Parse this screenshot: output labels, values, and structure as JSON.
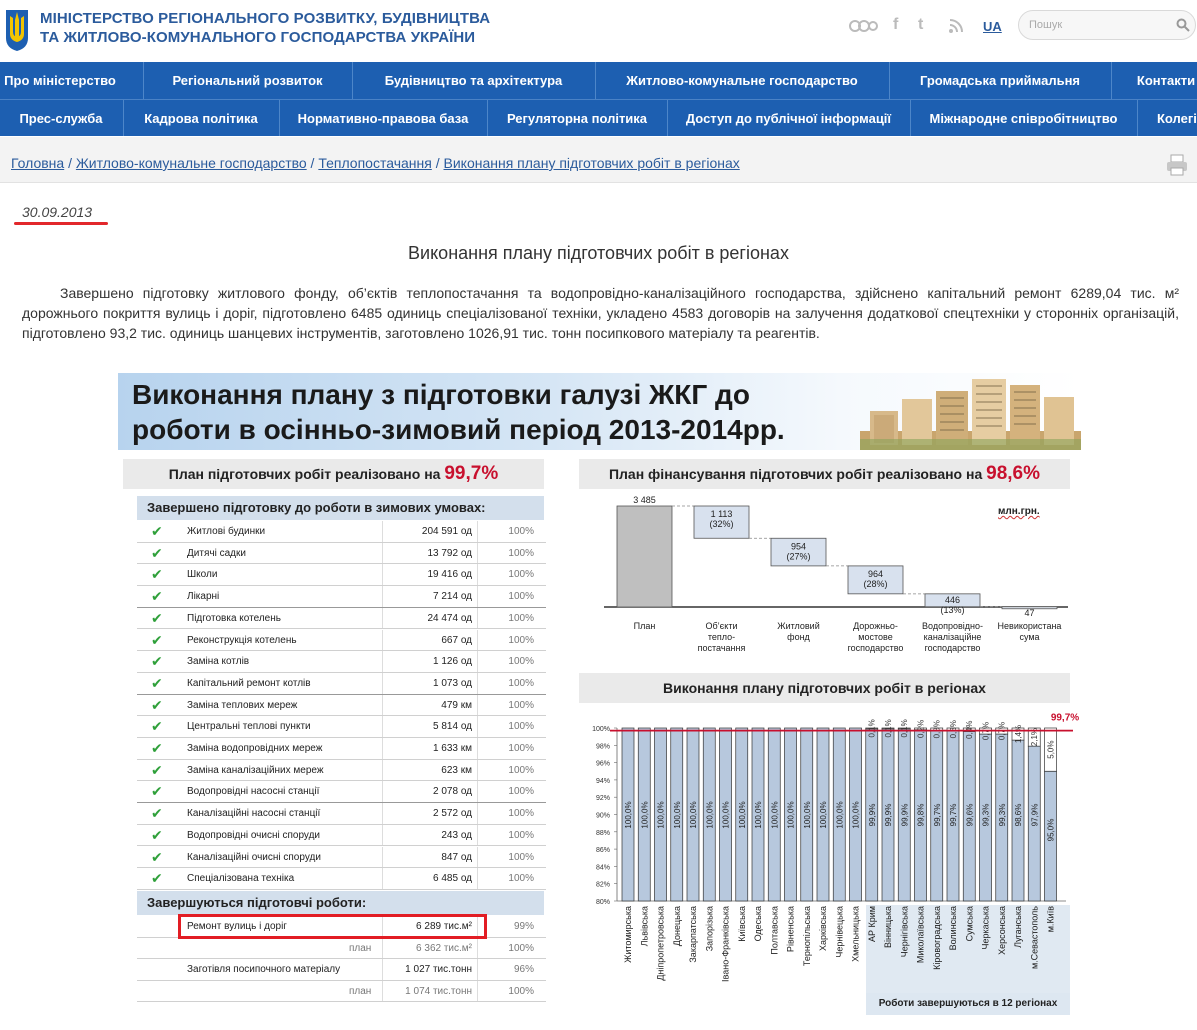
{
  "header": {
    "title_line1": "МІНІСТЕРСТВО РЕГІОНАЛЬНОГО РОЗВИТКУ, БУДІВНИЦТВА",
    "title_line2": "ТА ЖИТЛОВО-КОМУНАЛЬНОГО ГОСПОДАРСТВА УКРАЇНИ",
    "lang": "UA",
    "search_placeholder": "Пошук",
    "social": [
      "flickr-icon",
      "facebook-icon",
      "twitter-icon",
      "rss-icon"
    ]
  },
  "nav1": [
    "Про міністерство",
    "Регіональний розвиток",
    "Будівництво та архітектура",
    "Житлово-комунальне господарство",
    "Громадська приймальня",
    "Контакти"
  ],
  "nav2": [
    "Прес-служба",
    "Кадрова політика",
    "Нормативно-правова база",
    "Регуляторна політика",
    "Доступ до публічної інформації",
    "Міжнародне співробітництво",
    "Колегія"
  ],
  "breadcrumb": [
    "Головна",
    "Житлово-комунальне господарство",
    "Теплопостачання",
    "Виконання плану підготовчих робіт в регіонах"
  ],
  "article": {
    "date": "30.09.2013",
    "title": "Виконання плану підготовчих робіт в регіонах",
    "body": "Завершено підготовку житлового фонду, об’єктів теплопостачання та водопровідно-каналізаційного господарства, здійснено капітальний ремонт 6289,04 тис. м² дорожнього покриття вулиць і доріг, підготовлено 6485 одиниць спеціалізованої техніки, укладено 4583 договорів на залучення додаткової спецтехніки у сторонніх організацій, підготовлено 93,2 тис. одиниць шанцевих інструментів, заготовлено 1026,91 тис. тонн посипкового матеріалу та реагентів."
  },
  "infographic": {
    "banner_line1": "Виконання плану з підготовки галузі ЖКГ до",
    "banner_line2": "роботи в осінньо-зимовий період 2013-2014рр.",
    "left_header": "План підготовчих робіт реалізовано на",
    "left_pct": "99,7%",
    "completed_header": "Завершено підготовку до роботи в зимових умовах:",
    "completed": [
      {
        "name": "Житлові будинки",
        "value": "204 591 од",
        "pct": "100%"
      },
      {
        "name": "Дитячі садки",
        "value": "13 792 од",
        "pct": "100%"
      },
      {
        "name": "Школи",
        "value": "19 416 од",
        "pct": "100%"
      },
      {
        "name": "Лікарні",
        "value": "7 214 од",
        "pct": "100%"
      },
      {
        "name": "Підготовка котелень",
        "value": "24 474 од",
        "pct": "100%"
      },
      {
        "name": "Реконструкція котелень",
        "value": "667 од",
        "pct": "100%"
      },
      {
        "name": "Заміна котлів",
        "value": "1 126 од",
        "pct": "100%"
      },
      {
        "name": "Капітальний ремонт котлів",
        "value": "1 073 од",
        "pct": "100%"
      },
      {
        "name": "Заміна теплових мереж",
        "value": "479 км",
        "pct": "100%"
      },
      {
        "name": "Центральні теплові пункти",
        "value": "5 814 од",
        "pct": "100%"
      },
      {
        "name": "Заміна водопровідних мереж",
        "value": "1 633 км",
        "pct": "100%"
      },
      {
        "name": "Заміна каналізаційних мереж",
        "value": "623 км",
        "pct": "100%"
      },
      {
        "name": "Водопровідні насосні станції",
        "value": "2 078 од",
        "pct": "100%"
      },
      {
        "name": "Каналізаційні насосні станції",
        "value": "2 572 од",
        "pct": "100%"
      },
      {
        "name": "Водопровідні очисні споруди",
        "value": "243 од",
        "pct": "100%"
      },
      {
        "name": "Каналізаційні очисні споруди",
        "value": "847 од",
        "pct": "100%"
      },
      {
        "name": "Спеціалізована техніка",
        "value": "6 485 од",
        "pct": "100%"
      }
    ],
    "ongoing_header": "Завершуються підготовчі роботи:",
    "ongoing": [
      {
        "name": "Ремонт вулиць і доріг",
        "value": "6 289 тис.м²",
        "pct": "99%"
      },
      {
        "name": "план",
        "value": "6 362 тис.м²",
        "pct": "100%"
      },
      {
        "name": "Заготівля посипочного матеріалу",
        "value": "1 027 тис.тонн",
        "pct": "96%"
      },
      {
        "name": "план",
        "value": "1 074 тис.тонн",
        "pct": "100%"
      }
    ],
    "fin_header": "План фінансування підготовчих робіт реалізовано на",
    "fin_pct": "98,6%",
    "fin_unit": "млн.грн.",
    "regions_header": "Виконання плану підготовчих робіт в регіонах",
    "regions_footer": "Роботи завершуються в 12 регіонах"
  },
  "chart_data": [
    {
      "type": "bar",
      "title": "План фінансування підготовчих робіт реалізовано на 98,6%",
      "ylabel": "млн.грн.",
      "categories": [
        "План",
        "Об’єкти тепло-постачання",
        "Житловий фонд",
        "Дорожньо-мостове господарство",
        "Водопровідно-каналізаційне господарство",
        "Невикористана сума"
      ],
      "values": [
        3485,
        1113,
        954,
        964,
        446,
        47
      ],
      "labels": [
        "3 485",
        "1 113",
        "954",
        "964",
        "446",
        "47"
      ],
      "shares": [
        "",
        "(32%)",
        "(27%)",
        "(28%)",
        "(13%)",
        ""
      ]
    },
    {
      "type": "bar",
      "title": "Виконання плану підготовчих робіт в регіонах",
      "ylim": [
        80,
        100
      ],
      "yticks": [
        "80%",
        "82%",
        "84%",
        "86%",
        "88%",
        "90%",
        "92%",
        "94%",
        "96%",
        "98%",
        "100%"
      ],
      "target_label": "99,7%",
      "target": 99.7,
      "categories": [
        "Житомирська",
        "Львівська",
        "Дніпропетровська",
        "Донецька",
        "Закарпатська",
        "Запорізька",
        "Івано-Франківська",
        "Київська",
        "Одеська",
        "Полтавська",
        "Рівненська",
        "Тернопільська",
        "Харківська",
        "Чернівецька",
        "Хмельницька",
        "АР Крим",
        "Вінницька",
        "Чернігівська",
        "Миколаївська",
        "Кіровоградська",
        "Волинська",
        "Сумська",
        "Черкаська",
        "Херсонська",
        "Луганська",
        "м.Севастополь",
        "м.Київ"
      ],
      "series": [
        {
          "values": [
            100,
            100,
            100,
            100,
            100,
            100,
            100,
            100,
            100,
            100,
            100,
            100,
            100,
            100,
            100,
            99.9,
            99.9,
            99.9,
            99.8,
            99.7,
            99.7,
            99.6,
            99.3,
            99.3,
            98.6,
            97.9,
            95.0
          ],
          "labels": [
            "100,0%",
            "100,0%",
            "100,0%",
            "100,0%",
            "100,0%",
            "100,0%",
            "100,0%",
            "100,0%",
            "100,0%",
            "100,0%",
            "100,0%",
            "100,0%",
            "100,0%",
            "100,0%",
            "100,0%",
            "99,9%",
            "99,9%",
            "99,9%",
            "99,8%",
            "99,7%",
            "99,7%",
            "99,6%",
            "99,3%",
            "99,3%",
            "98,6%",
            "97,9%",
            "95,0%"
          ]
        },
        {
          "values": [
            0,
            0,
            0,
            0,
            0,
            0,
            0,
            0,
            0,
            0,
            0,
            0,
            0,
            0,
            0,
            0.1,
            0.1,
            0.1,
            0.2,
            0.3,
            0.3,
            0.4,
            0.7,
            0.7,
            1.4,
            2.1,
            5.0
          ],
          "labels": [
            "",
            "",
            "",
            "",
            "",
            "",
            "",
            "",
            "",
            "",
            "",
            "",
            "",
            "",
            "",
            "0,1%",
            "0,1%",
            "0,1%",
            "0,2%",
            "0,3%",
            "0,3%",
            "0,4%",
            "0,7%",
            "0,7%",
            "1,4%",
            "2,1%",
            "5,0%"
          ]
        }
      ]
    }
  ]
}
